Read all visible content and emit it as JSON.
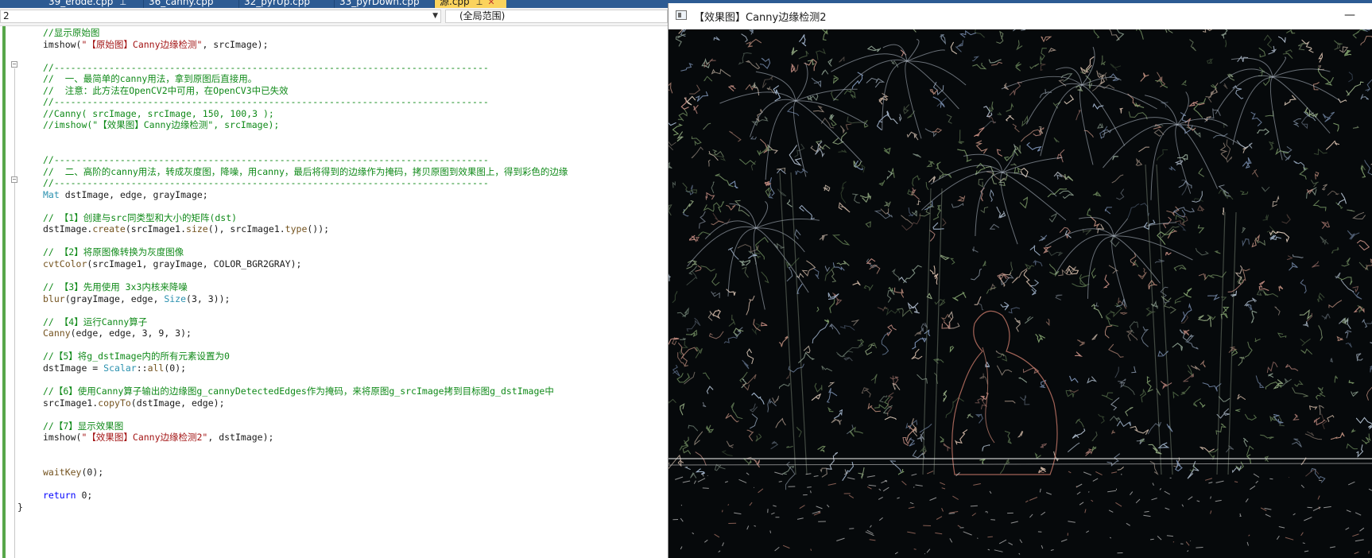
{
  "tabs": [
    {
      "label": "39_erode.cpp",
      "pinned": true,
      "active": false
    },
    {
      "label": "36_canny.cpp",
      "pinned": false,
      "active": false
    },
    {
      "label": "32_pyrUp.cpp",
      "pinned": false,
      "active": false
    },
    {
      "label": "33_pyrDown.cpp",
      "pinned": false,
      "active": false
    },
    {
      "label": "源.cpp",
      "pinned": true,
      "active": true
    }
  ],
  "navbar": {
    "project_value": "2",
    "scope_value": "(全局范围)"
  },
  "code_lines": [
    {
      "parts": [
        {
          "c": "cmt",
          "t": "//显示原始图"
        }
      ]
    },
    {
      "parts": [
        {
          "c": "",
          "t": "imshow("
        },
        {
          "c": "str",
          "t": "\"【原始图】Canny边缘检测\""
        },
        {
          "c": "",
          "t": ", srcImage);"
        }
      ]
    },
    {
      "parts": [
        {
          "c": "",
          "t": ""
        }
      ]
    },
    {
      "parts": [
        {
          "c": "cmt",
          "t": "//-------------------------------------------------------------------------------"
        }
      ]
    },
    {
      "parts": [
        {
          "c": "cmt",
          "t": "//  一、最简单的canny用法，拿到原图后直接用。"
        }
      ]
    },
    {
      "parts": [
        {
          "c": "cmt",
          "t": "//  注意：此方法在OpenCV2中可用，在OpenCV3中已失效"
        }
      ]
    },
    {
      "parts": [
        {
          "c": "cmt",
          "t": "//-------------------------------------------------------------------------------"
        }
      ]
    },
    {
      "parts": [
        {
          "c": "cmt",
          "t": "//Canny( srcImage, srcImage, 150, 100,3 );"
        }
      ]
    },
    {
      "parts": [
        {
          "c": "cmt",
          "t": "//imshow(\"【效果图】Canny边缘检测\", srcImage);"
        }
      ]
    },
    {
      "parts": [
        {
          "c": "",
          "t": ""
        }
      ]
    },
    {
      "parts": [
        {
          "c": "",
          "t": ""
        }
      ]
    },
    {
      "parts": [
        {
          "c": "cmt",
          "t": "//-------------------------------------------------------------------------------"
        }
      ]
    },
    {
      "parts": [
        {
          "c": "cmt",
          "t": "//  二、高阶的canny用法，转成灰度图，降噪，用canny，最后将得到的边缘作为掩码，拷贝原图到效果图上，得到彩色的边缘"
        }
      ]
    },
    {
      "parts": [
        {
          "c": "cmt",
          "t": "//-------------------------------------------------------------------------------"
        }
      ]
    },
    {
      "parts": [
        {
          "c": "typ",
          "t": "Mat"
        },
        {
          "c": "",
          "t": " dstImage, edge, grayImage;"
        }
      ]
    },
    {
      "parts": [
        {
          "c": "",
          "t": ""
        }
      ]
    },
    {
      "parts": [
        {
          "c": "cmt",
          "t": "// 【1】创建与src同类型和大小的矩阵(dst)"
        }
      ]
    },
    {
      "parts": [
        {
          "c": "",
          "t": "dstImage."
        },
        {
          "c": "fn",
          "t": "create"
        },
        {
          "c": "",
          "t": "(srcImage1."
        },
        {
          "c": "fn",
          "t": "size"
        },
        {
          "c": "",
          "t": "(), srcImage1."
        },
        {
          "c": "fn",
          "t": "type"
        },
        {
          "c": "",
          "t": "());"
        }
      ]
    },
    {
      "parts": [
        {
          "c": "",
          "t": ""
        }
      ]
    },
    {
      "parts": [
        {
          "c": "cmt",
          "t": "// 【2】将原图像转换为灰度图像"
        }
      ]
    },
    {
      "parts": [
        {
          "c": "fn",
          "t": "cvtColor"
        },
        {
          "c": "",
          "t": "(srcImage1, grayImage, COLOR_BGR2GRAY);"
        }
      ]
    },
    {
      "parts": [
        {
          "c": "",
          "t": ""
        }
      ]
    },
    {
      "parts": [
        {
          "c": "cmt",
          "t": "// 【3】先用使用 3x3内核来降噪"
        }
      ]
    },
    {
      "parts": [
        {
          "c": "fn",
          "t": "blur"
        },
        {
          "c": "",
          "t": "(grayImage, edge, "
        },
        {
          "c": "typ",
          "t": "Size"
        },
        {
          "c": "",
          "t": "(3, 3));"
        }
      ]
    },
    {
      "parts": [
        {
          "c": "",
          "t": ""
        }
      ]
    },
    {
      "parts": [
        {
          "c": "cmt",
          "t": "// 【4】运行Canny算子"
        }
      ]
    },
    {
      "parts": [
        {
          "c": "fn",
          "t": "Canny"
        },
        {
          "c": "",
          "t": "(edge, edge, 3, 9, 3);"
        }
      ]
    },
    {
      "parts": [
        {
          "c": "",
          "t": ""
        }
      ]
    },
    {
      "parts": [
        {
          "c": "cmt",
          "t": "//【5】将g_dstImage内的所有元素设置为0"
        }
      ]
    },
    {
      "parts": [
        {
          "c": "",
          "t": "dstImage = "
        },
        {
          "c": "typ",
          "t": "Scalar"
        },
        {
          "c": "",
          "t": "::"
        },
        {
          "c": "fn",
          "t": "all"
        },
        {
          "c": "",
          "t": "(0);"
        }
      ]
    },
    {
      "parts": [
        {
          "c": "",
          "t": ""
        }
      ]
    },
    {
      "parts": [
        {
          "c": "cmt",
          "t": "//【6】使用Canny算子输出的边缘图g_cannyDetectedEdges作为掩码，来将原图g_srcImage拷到目标图g_dstImage中"
        }
      ]
    },
    {
      "parts": [
        {
          "c": "",
          "t": "srcImage1."
        },
        {
          "c": "fn",
          "t": "copyTo"
        },
        {
          "c": "",
          "t": "(dstImage, edge);"
        }
      ]
    },
    {
      "parts": [
        {
          "c": "",
          "t": ""
        }
      ]
    },
    {
      "parts": [
        {
          "c": "cmt",
          "t": "//【7】显示效果图"
        }
      ]
    },
    {
      "parts": [
        {
          "c": "",
          "t": "imshow("
        },
        {
          "c": "str",
          "t": "\"【效果图】Canny边缘检测2\""
        },
        {
          "c": "",
          "t": ", dstImage);"
        }
      ]
    },
    {
      "parts": [
        {
          "c": "",
          "t": ""
        }
      ]
    },
    {
      "parts": [
        {
          "c": "",
          "t": ""
        }
      ]
    },
    {
      "parts": [
        {
          "c": "fn",
          "t": "waitKey"
        },
        {
          "c": "",
          "t": "(0);"
        }
      ]
    },
    {
      "parts": [
        {
          "c": "",
          "t": ""
        }
      ]
    },
    {
      "parts": [
        {
          "c": "kw",
          "t": "return"
        },
        {
          "c": "",
          "t": " 0;"
        }
      ]
    },
    {
      "parts": [
        {
          "c": "",
          "t": "}"
        }
      ]
    }
  ],
  "image_window": {
    "title": "【效果图】Canny边缘检测2",
    "icon": "window-app-icon",
    "minimize_glyph": "—"
  }
}
